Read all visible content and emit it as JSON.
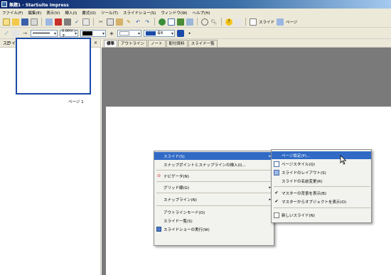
{
  "window": {
    "title": "無題1 - StarSuite Impress"
  },
  "menubar": {
    "items": [
      "ファイル(F)",
      "編集(E)",
      "表示(V)",
      "挿入(I)",
      "書式(O)",
      "ツール(T)",
      "スライドショー(S)",
      "ウィンドウ(W)",
      "ヘルプ(H)"
    ]
  },
  "toolbar1": {
    "slide_button_label": "スライド",
    "pagesetup_label": "ページ"
  },
  "toolbar2": {
    "line_width": "0.00センチ",
    "fill_value": "青8"
  },
  "left_pane": {
    "title": "スライド",
    "close": "×",
    "slide_number": "1",
    "slide_caption": "ページ 1"
  },
  "tabs": [
    "標準",
    "アウトライン",
    "ノート",
    "配付資料",
    "スライド一覧"
  ],
  "context_menu": {
    "items": [
      {
        "label": "スライド(S)"
      },
      {
        "label": "スナップポイントとスナップラインの挿入(I)..."
      },
      {
        "label": "ナビゲータ(N)"
      },
      {
        "label": "グリッド線(G)"
      },
      {
        "label": "スナップライン(N)"
      },
      {
        "label": "アウトラインモード(O)"
      },
      {
        "label": "スライド一覧(S)"
      },
      {
        "label": "スライドショーの実行(W)"
      }
    ]
  },
  "submenu": {
    "items": [
      {
        "label": "ページ設定(P)..."
      },
      {
        "label": "ページスタイル(Q)"
      },
      {
        "label": "スライドのレイアウト(S)"
      },
      {
        "label": "スライドの名前変更(R)"
      },
      {
        "label": "マスターの背景を表示(B)"
      },
      {
        "label": "マスターからオブジェクトを表示(O)"
      },
      {
        "label": "新しいスライド(N)"
      }
    ]
  },
  "colors": {
    "highlight": "#316ac5",
    "workarea": "#7a7a7a",
    "menu_bg": "#f2f2ee",
    "selection_border": "#1c4aa7"
  }
}
